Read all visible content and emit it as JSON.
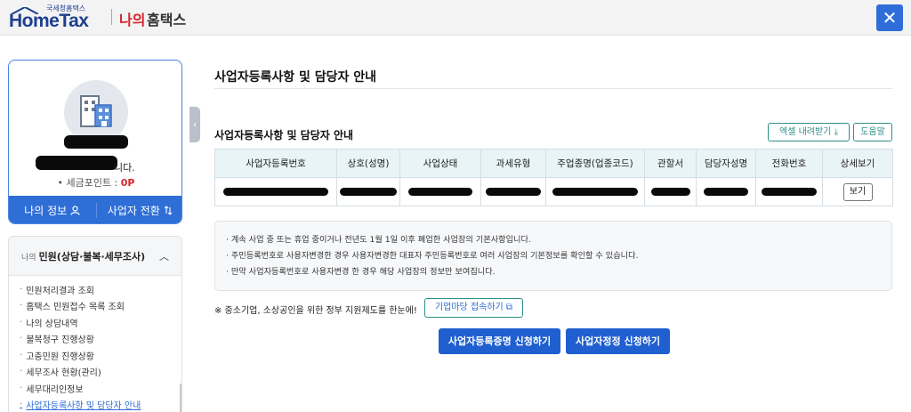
{
  "header": {
    "logo_small": "국세청홈택스",
    "logo_main": "HomeTax",
    "title_mine": "나의",
    "title_hometax": "홈택스",
    "close_label": "✕"
  },
  "profile": {
    "greeting_tail": "니다.",
    "points_label": "• 세금포인트 :",
    "points_value": "0P",
    "my_info_label": "나의 정보",
    "my_info_icon": "user-icon",
    "switch_label": "사업자 전환",
    "switch_icon": "swap-icon"
  },
  "menu": {
    "prefix": "나의",
    "title": "민원(상담·불복·세무조사)",
    "items": [
      "민원처리결과 조회",
      "홈택스 민원접수 목록 조회",
      "나의 상담내역",
      "불복청구 진행상황",
      "고충민원 진행상황",
      "세무조사 현황(관리)",
      "세무대리인정보",
      "사업자등록사항 및 담당자 안내"
    ]
  },
  "main": {
    "page_title": "사업자등록사항 및 담당자 안내",
    "section_title": "사업자등록사항 및 담당자 안내",
    "excel_label": "엑셀 내려받기",
    "help_label": "도움말",
    "table": {
      "headers": [
        "사업자등록번호",
        "상호(성명)",
        "사업상태",
        "과세유형",
        "주업종명(업종코드)",
        "관할서",
        "담당자성명",
        "전화번호",
        "상세보기"
      ],
      "view_label": "보기"
    },
    "notices": [
      "계속 사업 중 또는 휴업 중이거나 전년도 1월 1일 이후 폐업한 사업장의 기본사항입니다.",
      "주민등록번호로 사용자변경한 경우 사용자변경한 대표자 주민등록번호로 여러 사업장의 기본정보를 확인할 수 있습니다.",
      "만약 사업자등록번호로 사용자변경 한 경우 해당 사업장의 정보만 보여집니다."
    ],
    "support_text": "※ 중소기업, 소상공인을 위한 정부 지원제도를 한눈에!",
    "support_button": "기업마당 접속하기",
    "btn_certificate": "사업자등록증명 신청하기",
    "btn_correction": "사업자정정 신청하기"
  },
  "colors": {
    "primary": "#1f5fcf",
    "accent_red": "#d9222a",
    "teal": "#2e8f86",
    "table_header": "#e9f4f6"
  }
}
